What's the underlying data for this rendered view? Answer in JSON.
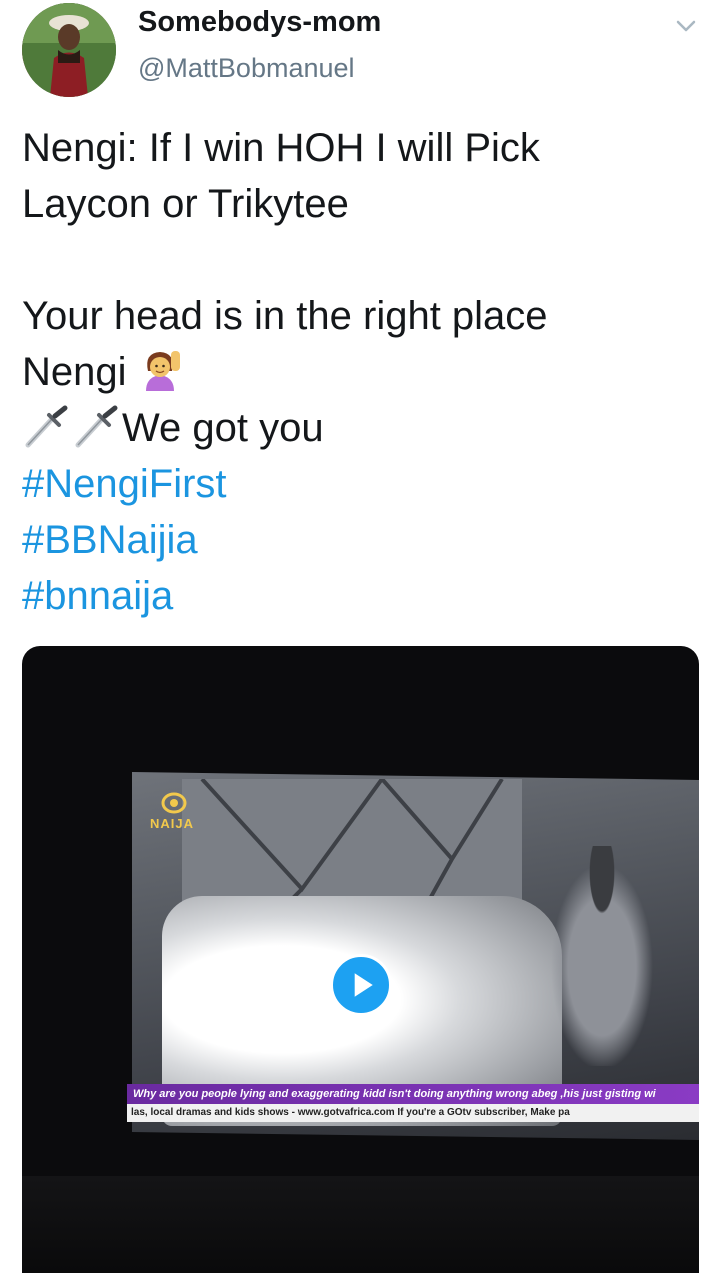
{
  "tweet": {
    "author": {
      "display_name": "Somebodys-mom",
      "handle": "@MattBobmanuel",
      "avatar_icon": "profile-avatar"
    },
    "menu_icon": "chevron-down-icon",
    "lines": {
      "l1": "Nengi: If I win HOH I will Pick",
      "l2": "Laycon or Trikytee",
      "l3": "Your head is in the right place",
      "l4": "Nengi",
      "l5": "We got you"
    },
    "hashtags": [
      "#NengiFirst",
      "#BBNaijia",
      "#bnnaija"
    ],
    "emojis": {
      "wave": "person-raising-hand-emoji",
      "dagger": "dagger-emoji"
    },
    "media": {
      "type": "video",
      "play_icon": "play-icon",
      "logo_text": "NAIJA",
      "ticker_top": "Why are you people lying and exaggerating kidd isn't doing anything wrong abeg ,his just gisting wi",
      "ticker_bottom": "las, local dramas and kids shows - www.gotvafrica.com    If you're a GOtv subscriber, Make pa"
    },
    "colors": {
      "hashtag": "#1b95e0",
      "text": "#14171a",
      "secondary": "#657786",
      "play_button": "#1da1f2"
    }
  }
}
